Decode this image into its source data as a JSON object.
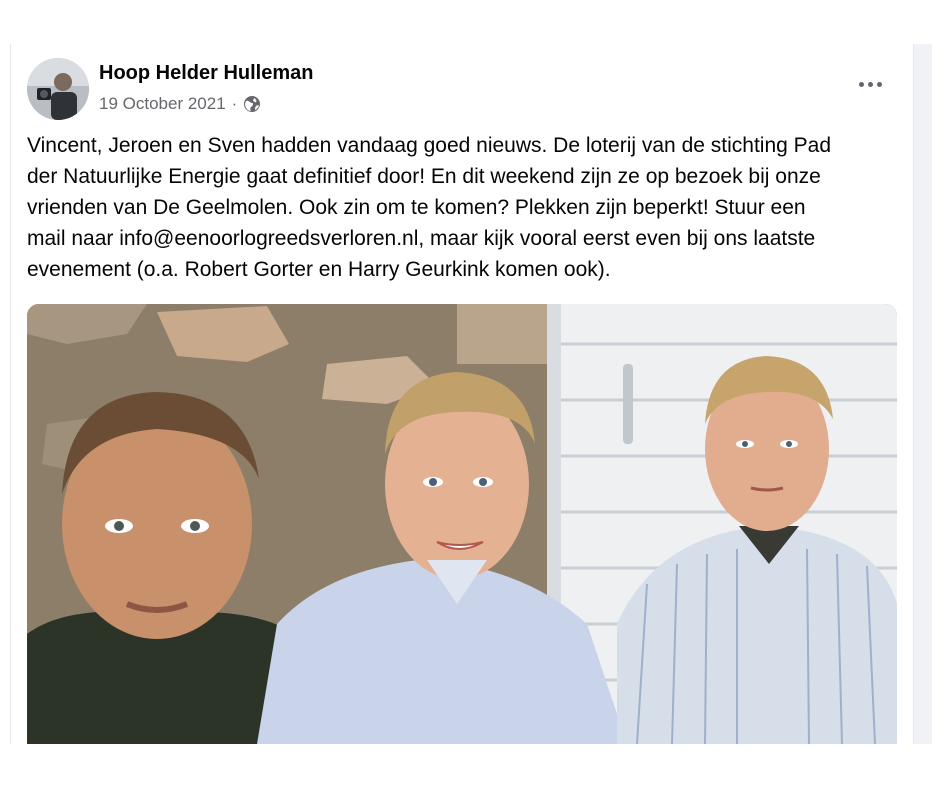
{
  "post": {
    "author": "Hoop Helder Hulleman",
    "date": "19 October 2021",
    "separator": "·",
    "privacy_icon": "globe-icon",
    "more_icon": "more-options-icon",
    "text_lines": [
      "Vincent, Jeroen en Sven hadden vandaag goed nieuws. De loterij van de stichting Pad",
      "der Natuurlijke Energie gaat definitief door! En dit weekend zijn ze op bezoek bij onze",
      "vrienden van De Geelmolen. Ook zin om te komen? Plekken zijn beperkt! Stuur een",
      "mail naar info@eenoorlogreedsverloren.nl, maar kijk vooral eerst even bij ons laatste",
      "evenement (o.a. Robert Gorter en Harry Geurkink komen ook)."
    ]
  },
  "colors": {
    "author_text": "#050505",
    "meta_text": "#65676b",
    "wall": "#e9ecef",
    "stone": "#8a7b66"
  }
}
